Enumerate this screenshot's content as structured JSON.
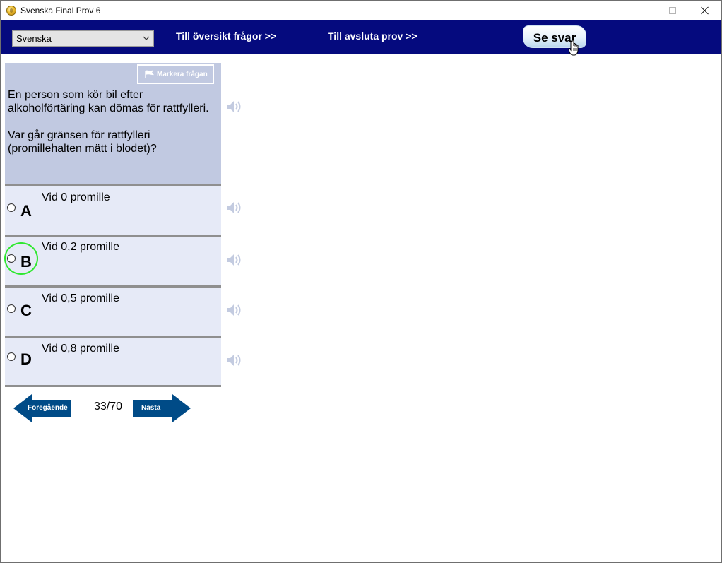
{
  "window": {
    "title": "Svenska Final Prov 6"
  },
  "toolbar": {
    "language_value": "Svenska",
    "overview_link": "Till översikt frågor >>",
    "finish_link": "Till avsluta prov  >>",
    "answer_button": "Se svar"
  },
  "question": {
    "mark_button": "Markera frågan",
    "paragraph_1": "En person som kör bil efter alkoholförtäring kan dömas för rattfylleri.",
    "paragraph_2": "Var går gränsen för rattfylleri (promillehalten mätt i blodet)?",
    "options": [
      {
        "letter": "A",
        "text": "Vid 0 promille"
      },
      {
        "letter": "B",
        "text": "Vid 0,2 promille"
      },
      {
        "letter": "C",
        "text": "Vid 0,5 promille"
      },
      {
        "letter": "D",
        "text": "Vid 0,8 promille"
      }
    ],
    "highlighted_option": "B"
  },
  "navigation": {
    "prev_label": "Föregående",
    "next_label": "Nästa",
    "counter": "33/70"
  },
  "colors": {
    "toolbar_bg": "#050a7e",
    "question_bg": "#c1c9e1",
    "option_bg": "#e6eaf7",
    "nav_arrow": "#004b87",
    "hint_circle": "#2ee82e"
  },
  "icons": {
    "app": "app-coin-icon",
    "speaker": "speaker-icon",
    "flag": "flag-icon",
    "cursor": "hand-cursor-icon"
  }
}
